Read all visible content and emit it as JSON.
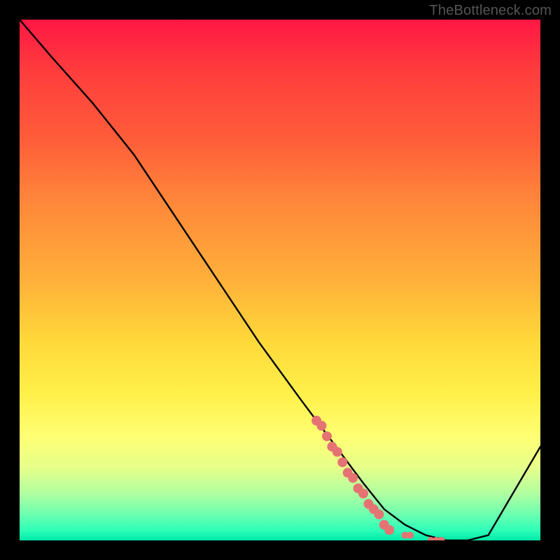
{
  "watermark": "TheBottleneck.com",
  "chart_data": {
    "type": "line",
    "title": "",
    "xlabel": "",
    "ylabel": "",
    "xlim": [
      0,
      100
    ],
    "ylim": [
      0,
      100
    ],
    "series": [
      {
        "name": "curve",
        "x": [
          0,
          6,
          14,
          22,
          30,
          38,
          46,
          54,
          60,
          66,
          70,
          74,
          78,
          82,
          86,
          90,
          100
        ],
        "values": [
          100,
          93,
          84,
          74,
          62,
          50,
          38,
          27,
          19,
          11,
          6,
          3,
          1,
          0,
          0,
          1,
          18
        ]
      }
    ],
    "highlight_points": {
      "name": "salmon-dots",
      "color": "#e57373",
      "x": [
        57,
        58,
        59,
        60,
        61,
        62,
        63,
        64,
        65,
        66,
        67,
        68,
        69,
        70,
        71,
        74,
        75,
        79,
        80,
        81
      ],
      "values": [
        23,
        22,
        20,
        18,
        17,
        15,
        13,
        12,
        10,
        9,
        7,
        6,
        5,
        3,
        2,
        1,
        1,
        0,
        0,
        0
      ]
    }
  }
}
